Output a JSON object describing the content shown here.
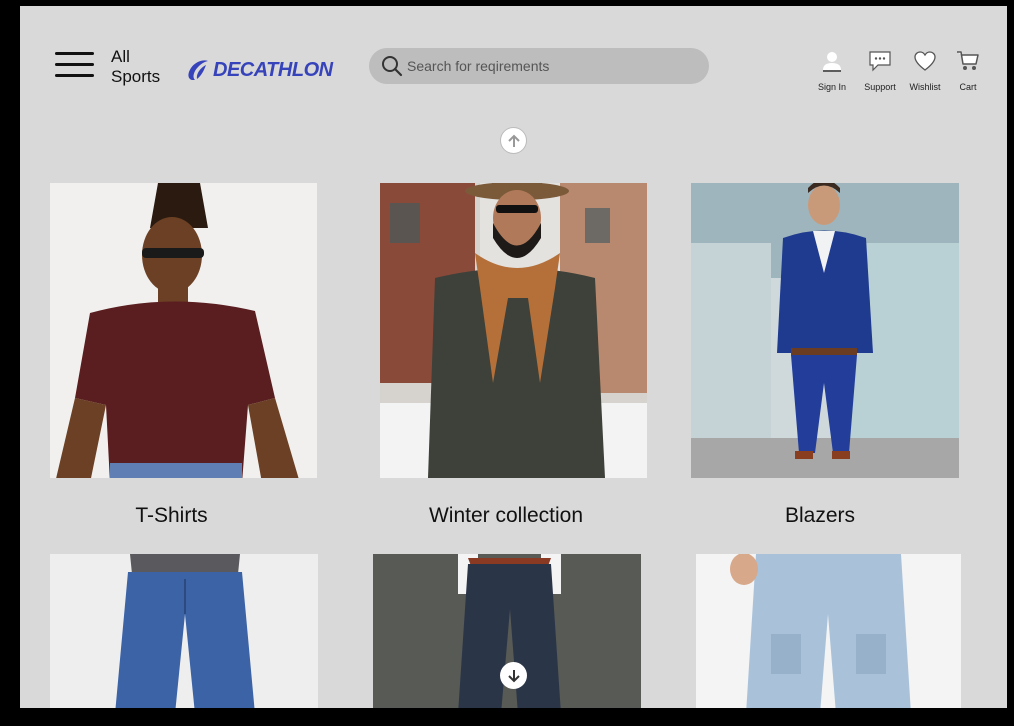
{
  "header": {
    "all_sports_label": "All Sports",
    "brand": "DECATHLON",
    "brand_color": "#3643ba",
    "search": {
      "placeholder": "Search for reqirements",
      "value": "",
      "icon": "search-icon"
    },
    "nav": [
      {
        "label": "Sign In",
        "icon": "user-icon"
      },
      {
        "label": "Support",
        "icon": "chat-bubble-icon"
      },
      {
        "label": "Wishlist",
        "icon": "heart-icon"
      },
      {
        "label": "Cart",
        "icon": "cart-icon"
      }
    ]
  },
  "categories": [
    {
      "label": "T-Shirts"
    },
    {
      "label": "Winter collection"
    },
    {
      "label": "Blazers"
    },
    {
      "label": ""
    },
    {
      "label": ""
    },
    {
      "label": ""
    }
  ]
}
